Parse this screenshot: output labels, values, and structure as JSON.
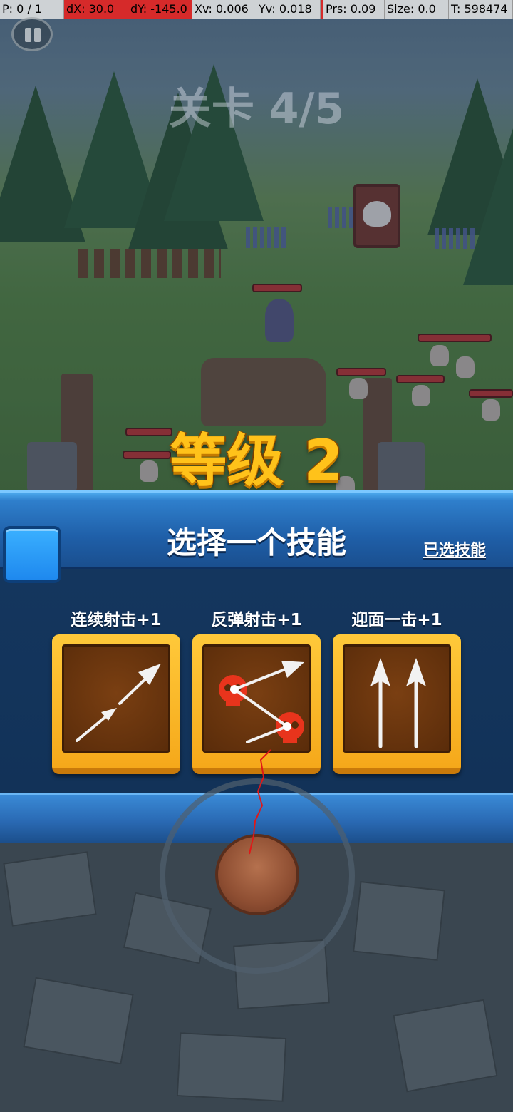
{
  "debug": {
    "pointer": "P: 0 / 1",
    "dx": "dX: 30.0",
    "dy": "dY: -145.0",
    "xv": "Xv: 0.006",
    "yv": "Yv: 0.018",
    "prs": "Prs: 0.09",
    "size": "Size: 0.0",
    "time": "T: 598474"
  },
  "hud": {
    "stage": "关卡 4/5",
    "level": "等级 2"
  },
  "panel": {
    "title": "选择一个技能",
    "chosen_link": "已选技能"
  },
  "skills": [
    {
      "label": "连续射击+1",
      "icon": "double-arrow-icon"
    },
    {
      "label": "反弹射击+1",
      "icon": "bounce-arrow-icon"
    },
    {
      "label": "迎面一击+1",
      "icon": "front-arrows-icon"
    }
  ],
  "colors": {
    "level_gold": "#ffc21a",
    "panel_blue": "#1f5fa8",
    "card_gold": "#f5a81a",
    "card_inner": "#5a2c0a",
    "skull_red": "#e8341c"
  }
}
